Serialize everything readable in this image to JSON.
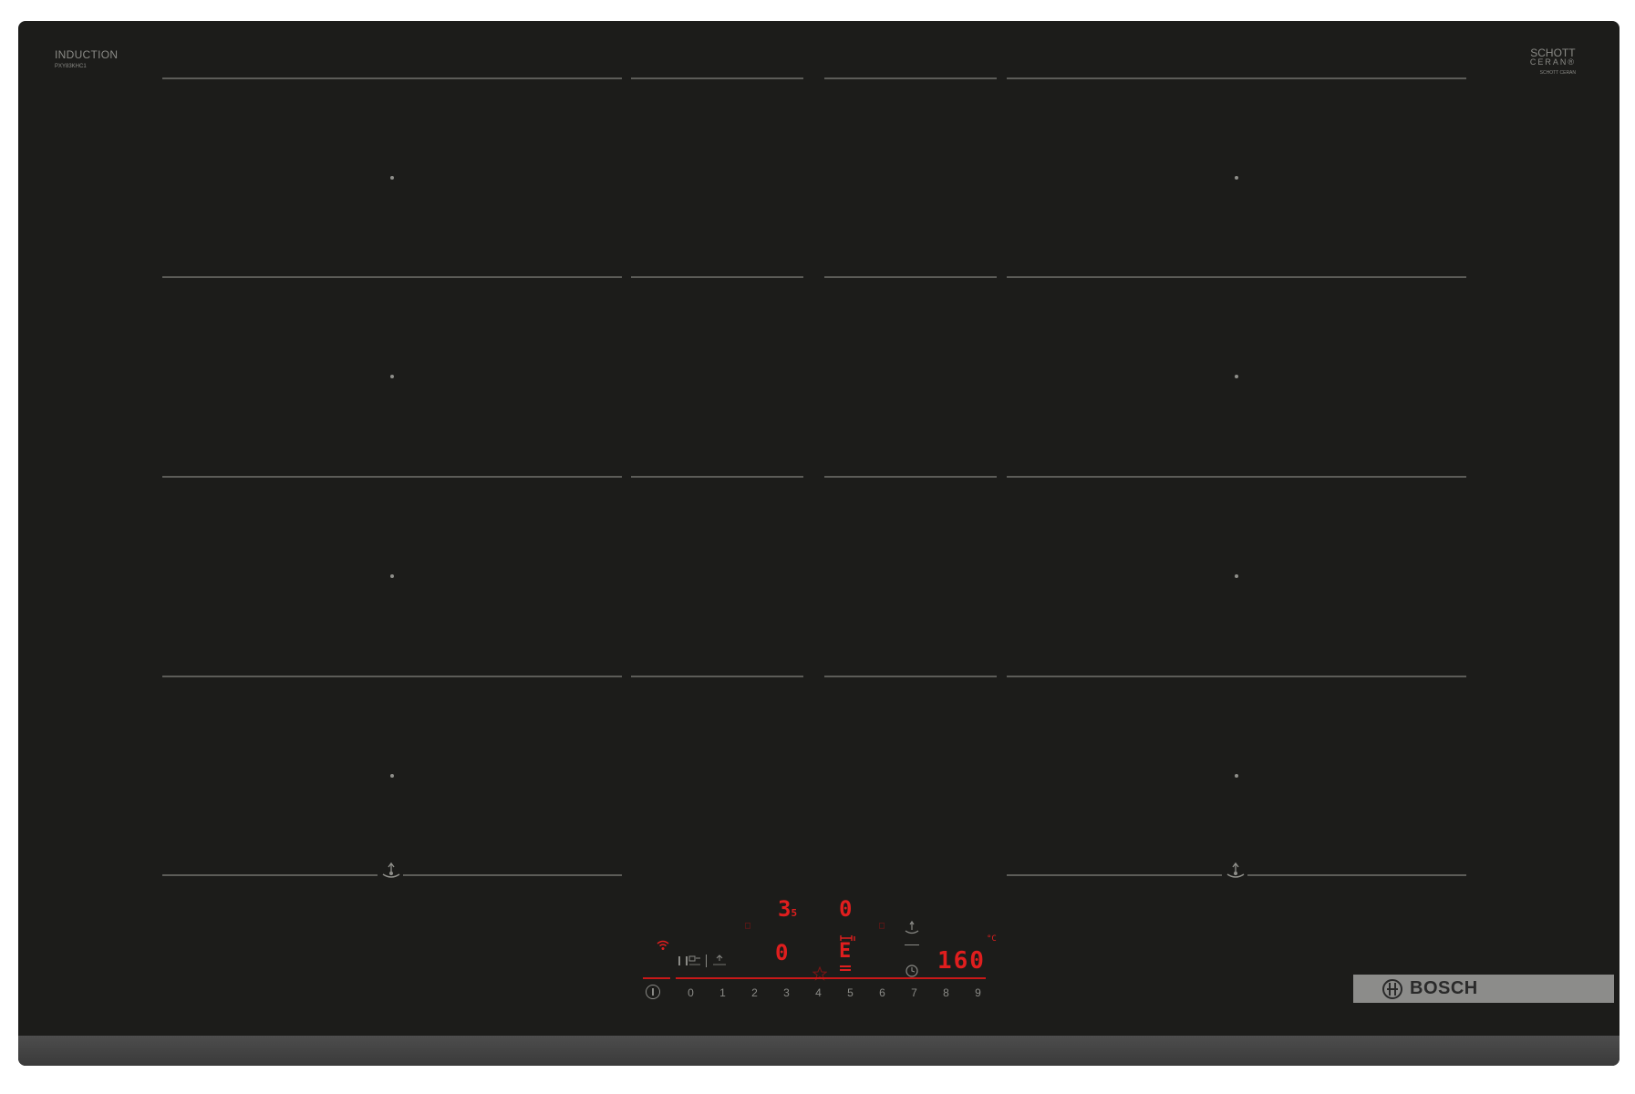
{
  "branding": {
    "product_line": "INDUCTION",
    "product_subline": "PXY83KHC1",
    "glass_brand_line1": "SCHOTT",
    "glass_brand_line2": "CERAN®",
    "glass_brand_line3": "SCHOTT CERAN",
    "manufacturer": "BOSCH"
  },
  "display": {
    "zone_top_value": "3",
    "zone_top_subscript": "5",
    "zone_top_right_value": "0",
    "zone_center_value": "0",
    "zone_center_right_value": "E",
    "temperature_value": "160",
    "temperature_unit": "°C"
  },
  "controls": {
    "power_scale": [
      "0",
      "1",
      "2",
      "3",
      "4",
      "5",
      "6",
      "7",
      "8",
      "9"
    ],
    "buttons": [
      "wifi",
      "flex",
      "boost",
      "favourite",
      "pan-sensor",
      "timer",
      "power"
    ]
  },
  "colors": {
    "glass": "#1c1c1a",
    "zone_lines": "#5c5c58",
    "display_red": "#e01e1e",
    "frame": "#4d4d4d",
    "plate": "#8c8c8a"
  }
}
